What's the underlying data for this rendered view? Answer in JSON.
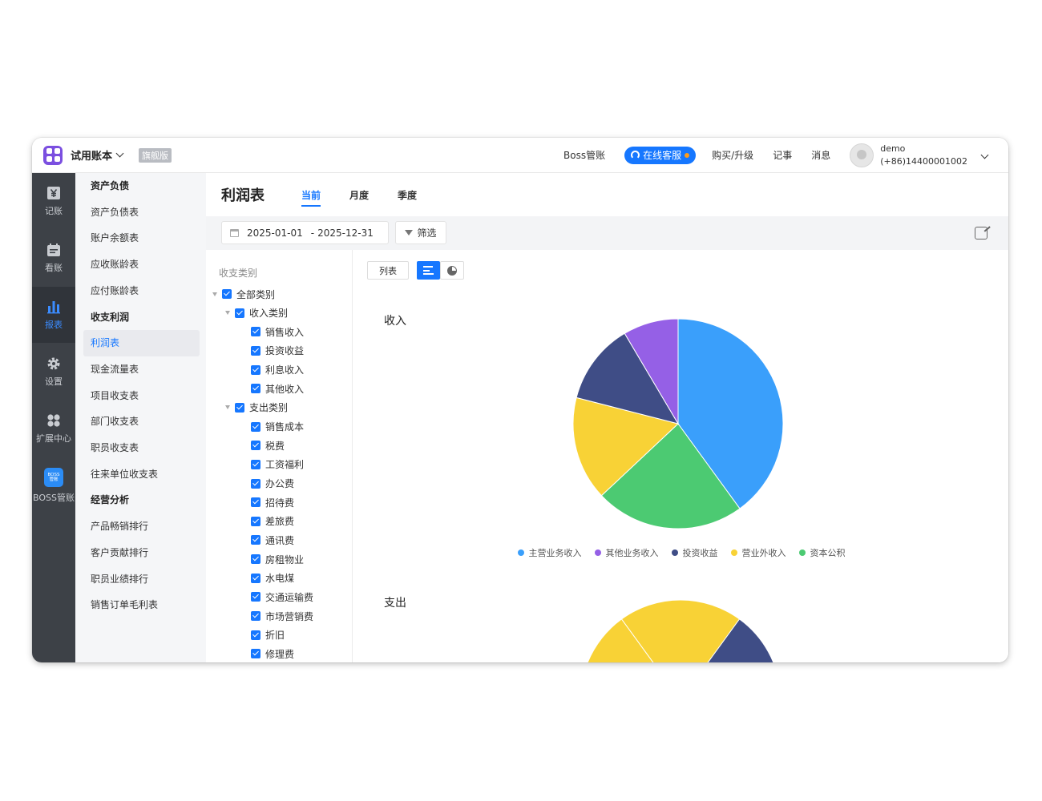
{
  "topbar": {
    "account_name": "试用账本",
    "edition_badge": "旗舰版",
    "boss_link": "Boss管账",
    "service_button": "在线客服",
    "buy_link": "购买/升级",
    "notes_link": "记事",
    "messages_link": "消息",
    "user_name": "demo",
    "user_phone": "(+86)14400001002"
  },
  "rail": [
    {
      "label": "记账",
      "icon": "yen-icon"
    },
    {
      "label": "看账",
      "icon": "calendar-icon"
    },
    {
      "label": "报表",
      "icon": "bar-chart-icon"
    },
    {
      "label": "设置",
      "icon": "gear-icon"
    },
    {
      "label": "扩展中心",
      "icon": "apps-icon"
    },
    {
      "label": "BOSS管账",
      "icon": "boss-logo-icon",
      "logo_text": "BOSS 管账"
    }
  ],
  "submenu": [
    {
      "label": "资产负债",
      "group": true
    },
    {
      "label": "资产负债表"
    },
    {
      "label": "账户余额表"
    },
    {
      "label": "应收账龄表"
    },
    {
      "label": "应付账龄表"
    },
    {
      "label": "收支利润",
      "group": true
    },
    {
      "label": "利润表",
      "active": true
    },
    {
      "label": "现金流量表"
    },
    {
      "label": "项目收支表"
    },
    {
      "label": "部门收支表"
    },
    {
      "label": "职员收支表"
    },
    {
      "label": "往来单位收支表"
    },
    {
      "label": "经营分析",
      "group": true
    },
    {
      "label": "产品畅销排行"
    },
    {
      "label": "客户贡献排行"
    },
    {
      "label": "职员业绩排行"
    },
    {
      "label": "销售订单毛利表"
    }
  ],
  "page": {
    "title": "利润表",
    "tabs": [
      "当前",
      "月度",
      "季度"
    ],
    "date_start": "2025-01-01",
    "date_sep": "-",
    "date_end": "2025-12-31",
    "filter_label": "筛选",
    "view_list_label": "列表"
  },
  "tree": {
    "header": "收支类别",
    "rows": [
      {
        "label": "全部类别",
        "level": 0,
        "caret": true
      },
      {
        "label": "收入类别",
        "level": 1,
        "caret": true
      },
      {
        "label": "销售收入",
        "level": 2
      },
      {
        "label": "投资收益",
        "level": 2
      },
      {
        "label": "利息收入",
        "level": 2
      },
      {
        "label": "其他收入",
        "level": 2
      },
      {
        "label": "支出类别",
        "level": 1,
        "caret": true
      },
      {
        "label": "销售成本",
        "level": 2
      },
      {
        "label": "税费",
        "level": 2
      },
      {
        "label": "工资福利",
        "level": 2
      },
      {
        "label": "办公费",
        "level": 2
      },
      {
        "label": "招待费",
        "level": 2
      },
      {
        "label": "差旅费",
        "level": 2
      },
      {
        "label": "通讯费",
        "level": 2
      },
      {
        "label": "房租物业",
        "level": 2
      },
      {
        "label": "水电煤",
        "level": 2
      },
      {
        "label": "交通运输费",
        "level": 2
      },
      {
        "label": "市场营销费",
        "level": 2
      },
      {
        "label": "折旧",
        "level": 2
      },
      {
        "label": "修理费",
        "level": 2
      }
    ]
  },
  "chart_data": [
    {
      "type": "pie",
      "title": "收入",
      "series": [
        {
          "name": "主营业务收入",
          "value": 40,
          "color": "#3a9ffb"
        },
        {
          "name": "资本公积",
          "value": 23,
          "color": "#4cca72"
        },
        {
          "name": "营业外收入",
          "value": 16,
          "color": "#f8d236"
        },
        {
          "name": "投资收益",
          "value": 12.5,
          "color": "#3f4d86"
        },
        {
          "name": "其他业务收入",
          "value": 8.5,
          "color": "#9560e6"
        }
      ],
      "legend_order": [
        "主营业务收入",
        "其他业务收入",
        "投资收益",
        "营业外收入",
        "资本公积"
      ],
      "legend": "bottom"
    },
    {
      "type": "pie",
      "title": "支出",
      "series": [
        {
          "name": "",
          "value": 14,
          "color": "#3f4d86"
        },
        {
          "name": "",
          "value": 10,
          "color": "#4cca72"
        },
        {
          "name": "",
          "value": 56,
          "color": "#f8d236"
        },
        {
          "name": "",
          "value": 20,
          "color": "#f8d236"
        }
      ]
    }
  ]
}
